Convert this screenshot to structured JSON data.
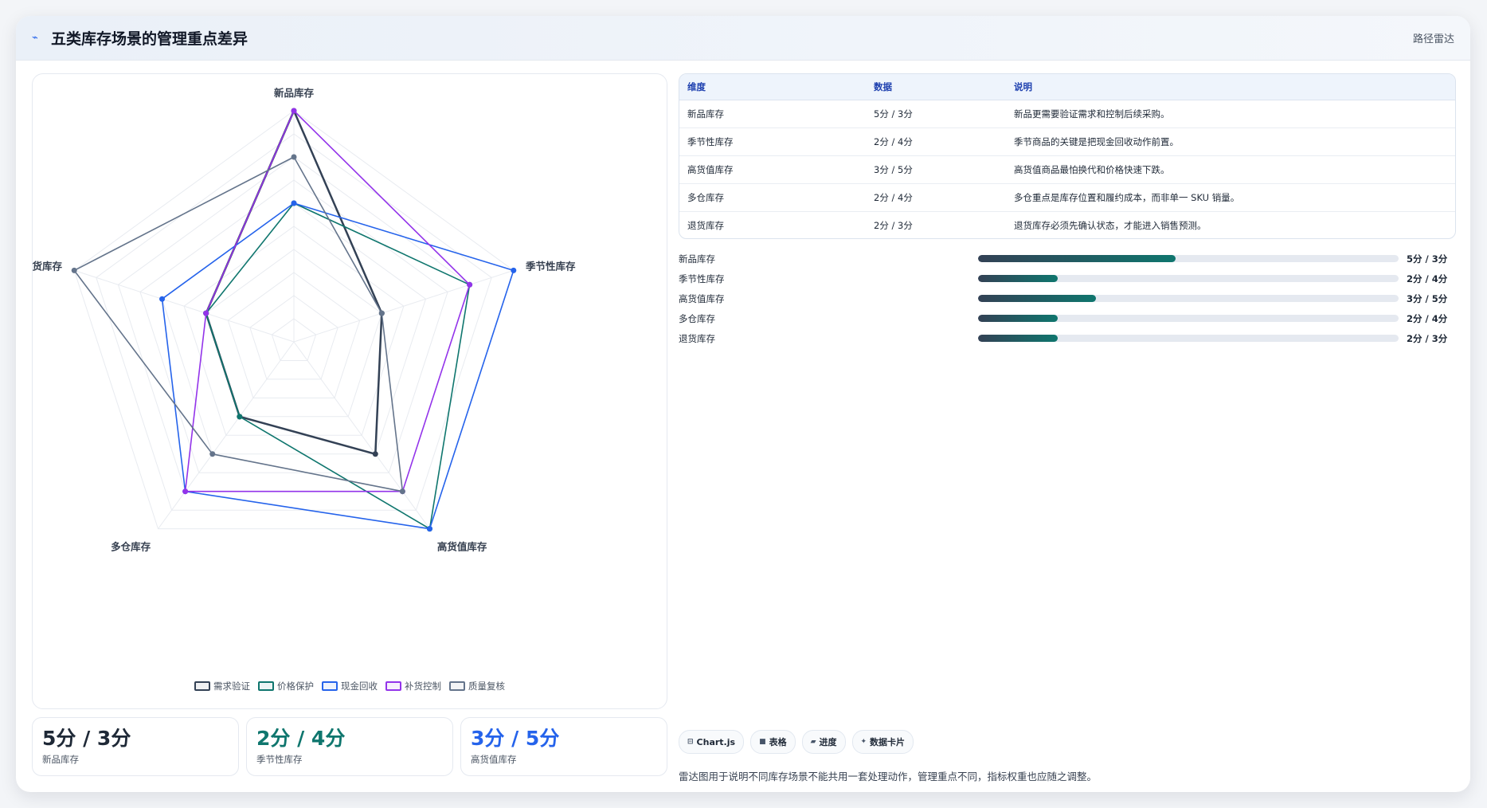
{
  "header": {
    "icon": "trend-line-icon",
    "title": "五类库存场景的管理重点差异",
    "tag": "路径雷达"
  },
  "chart_data": {
    "type": "radar",
    "axes": [
      "新品库存",
      "季节性库存",
      "高货值库存",
      "多仓库存",
      "退货库存"
    ],
    "range": [
      0,
      5
    ],
    "rings": 10,
    "series": [
      {
        "name": "需求验证",
        "color": "#334155",
        "values": [
          5,
          2,
          3,
          2,
          2
        ]
      },
      {
        "name": "价格保护",
        "color": "#0f766e",
        "values": [
          3,
          4,
          5,
          2,
          2
        ]
      },
      {
        "name": "现金回收",
        "color": "#2563eb",
        "values": [
          3,
          5,
          5,
          4,
          3
        ]
      },
      {
        "name": "补货控制",
        "color": "#9333ea",
        "values": [
          5,
          4,
          4,
          4,
          2
        ]
      },
      {
        "name": "质量复核",
        "color": "#64748b",
        "values": [
          4,
          2,
          4,
          3,
          5
        ]
      }
    ]
  },
  "kpis": [
    {
      "value": "5分 / 3分",
      "label": "新品库存",
      "color": "#1f2937"
    },
    {
      "value": "2分 / 4分",
      "label": "季节性库存",
      "color": "#0f766e"
    },
    {
      "value": "3分 / 5分",
      "label": "高货值库存",
      "color": "#2563eb"
    }
  ],
  "table": {
    "headers": [
      "维度",
      "数据",
      "说明"
    ],
    "rows": [
      [
        "新品库存",
        "5分 / 3分",
        "新品更需要验证需求和控制后续采购。"
      ],
      [
        "季节性库存",
        "2分 / 4分",
        "季节商品的关键是把现金回收动作前置。"
      ],
      [
        "高货值库存",
        "3分 / 5分",
        "高货值商品最怕换代和价格快速下跌。"
      ],
      [
        "多仓库存",
        "2分 / 4分",
        "多仓重点是库存位置和履约成本，而非单一 SKU 销量。"
      ],
      [
        "退货库存",
        "2分 / 3分",
        "退货库存必须先确认状态，才能进入销售预测。"
      ]
    ]
  },
  "bars": [
    {
      "label": "新品库存",
      "value": "5分 / 3分",
      "fraction": 0.47
    },
    {
      "label": "季节性库存",
      "value": "2分 / 4分",
      "fraction": 0.19
    },
    {
      "label": "高货值库存",
      "value": "3分 / 5分",
      "fraction": 0.28
    },
    {
      "label": "多仓库存",
      "value": "2分 / 4分",
      "fraction": 0.19
    },
    {
      "label": "退货库存",
      "value": "2分 / 3分",
      "fraction": 0.19
    }
  ],
  "chips": [
    {
      "icon": "chart-icon",
      "glyph": "⊟",
      "label": "Chart.js"
    },
    {
      "icon": "table-icon",
      "glyph": "■",
      "label": "表格"
    },
    {
      "icon": "progress-icon",
      "glyph": "▰",
      "label": "进度"
    },
    {
      "icon": "data-card-icon",
      "glyph": "✦",
      "label": "数据卡片"
    }
  ],
  "footnote": "雷达图用于说明不同库存场景不能共用一套处理动作，管理重点不同，指标权重也应随之调整。"
}
